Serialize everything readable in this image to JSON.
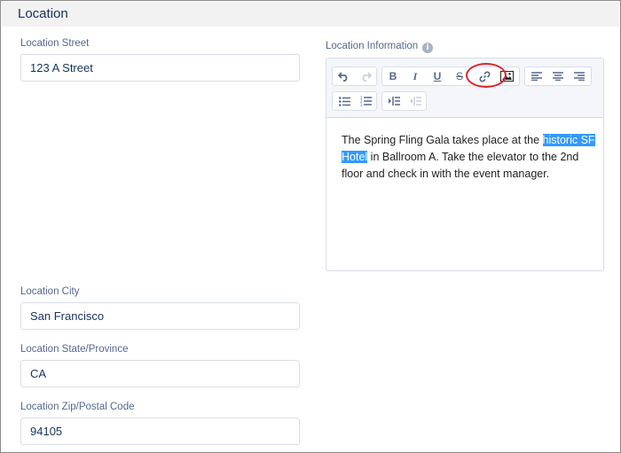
{
  "section": {
    "title": "Location"
  },
  "fields": {
    "street": {
      "label": "Location Street",
      "value": "123 A Street"
    },
    "city": {
      "label": "Location City",
      "value": "San Francisco"
    },
    "state": {
      "label": "Location State/Province",
      "value": "CA"
    },
    "zip": {
      "label": "Location Zip/Postal Code",
      "value": "94105"
    }
  },
  "info": {
    "label": "Location Information",
    "info_icon": "i",
    "content": {
      "before": "The Spring Fling Gala takes place at the ",
      "selected": "historic SF Hotel",
      "after": " in Ballroom A. Take the elevator to the 2nd floor and check in with the event manager."
    }
  },
  "toolbar": {
    "bold": "B",
    "italic": "I",
    "underline": "U",
    "strike": "S",
    "icons": [
      "undo-icon",
      "redo-icon",
      "bold-icon",
      "italic-icon",
      "underline-icon",
      "strikethrough-icon",
      "link-icon",
      "image-icon",
      "align-left-icon",
      "align-center-icon",
      "align-right-icon",
      "bulleted-list-icon",
      "numbered-list-icon",
      "indent-icon",
      "outdent-icon"
    ]
  },
  "colors": {
    "highlight_ring": "#d8262b",
    "selection": "#3399ff",
    "header_bg": "#f3f2f2"
  }
}
